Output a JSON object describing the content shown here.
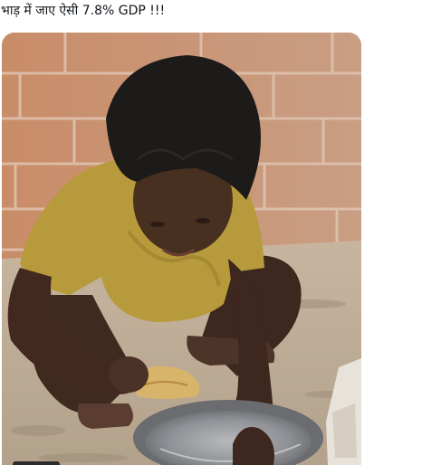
{
  "post": {
    "text": "भाड़ में जाए ऐसी 7.8% GDP !!!"
  },
  "media": {
    "type": "video-frame",
    "colors": {
      "wall": "#c98f6c",
      "mortar": "#d9b9a2",
      "ground": "#bfae98",
      "shirt": "#b99a3c",
      "skin": "#4a3328",
      "hair": "#1d1a1a",
      "bowl": "#8c8d92"
    }
  }
}
